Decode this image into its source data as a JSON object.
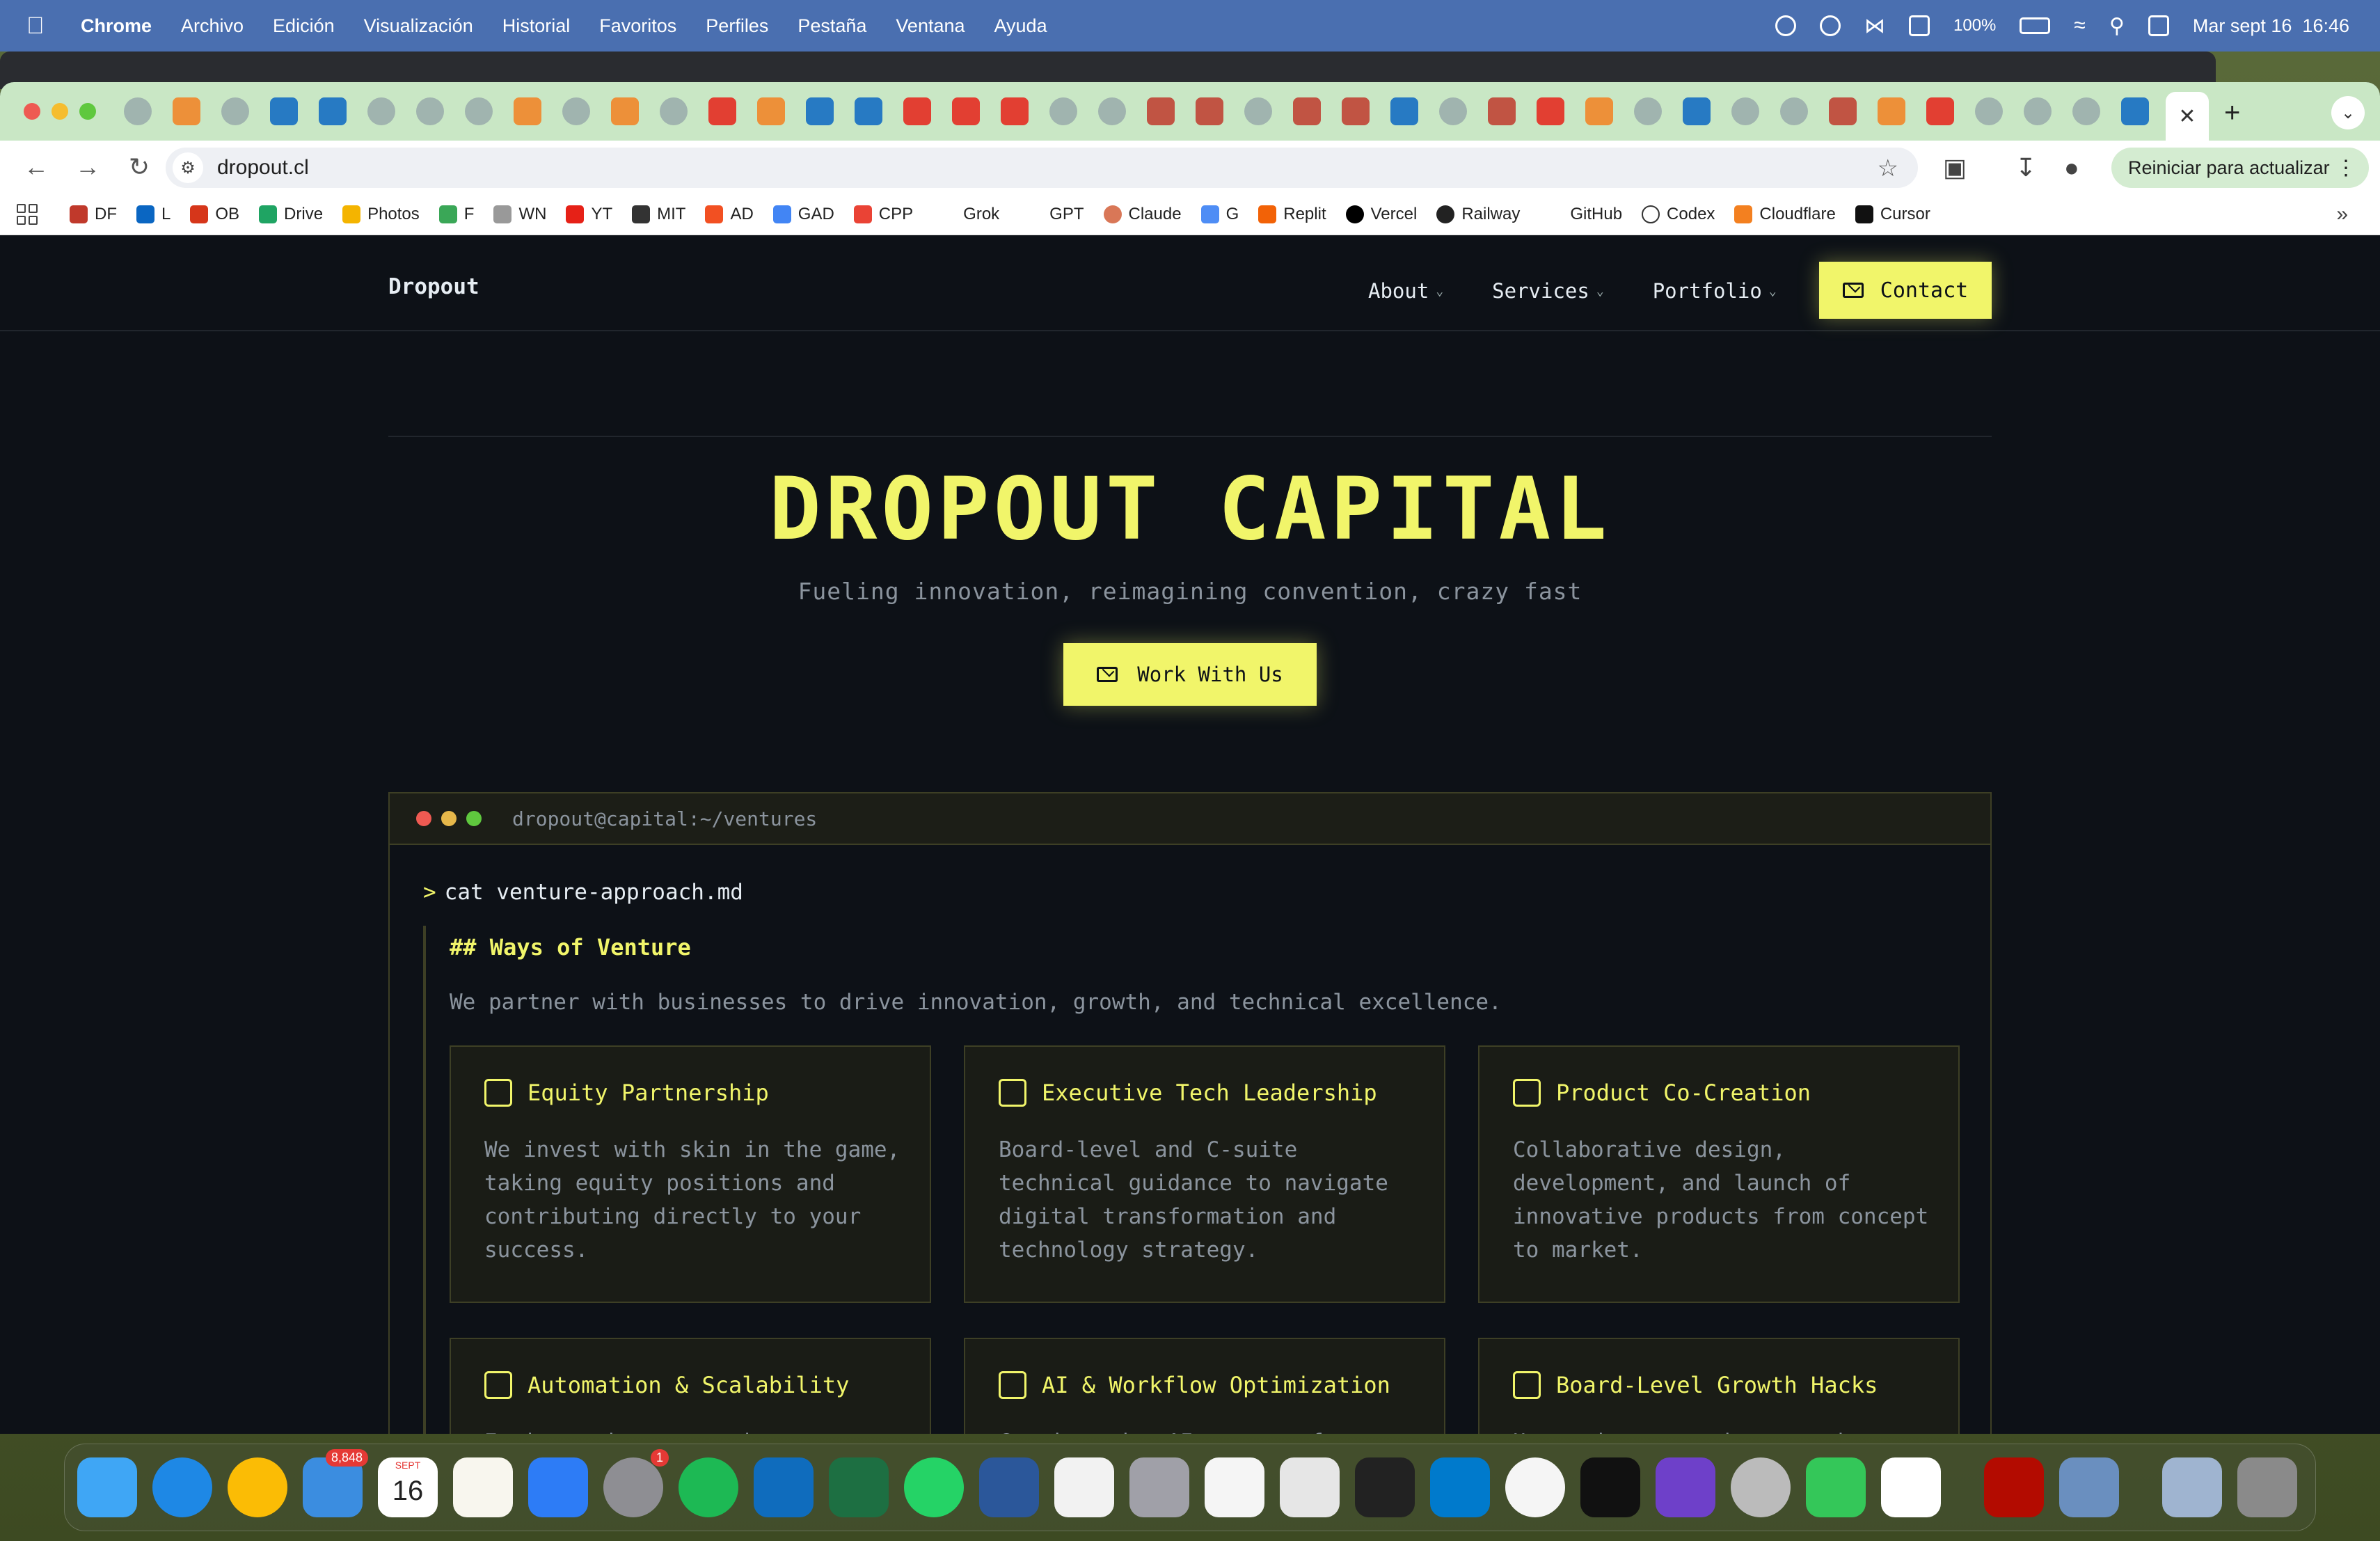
{
  "menubar": {
    "app": "Chrome",
    "items": [
      "Archivo",
      "Edición",
      "Visualización",
      "Historial",
      "Favoritos",
      "Perfiles",
      "Pestaña",
      "Ventana",
      "Ayuda"
    ],
    "battery": "100%",
    "datetime": "Mar sept 16  16:46"
  },
  "browser": {
    "url": "dropout.cl",
    "update_button": "Reiniciar para actualizar",
    "bookmarks": [
      "DF",
      "L",
      "OB",
      "Drive",
      "Photos",
      "F",
      "WN",
      "YT",
      "MIT",
      "AD",
      "GAD",
      "CPP",
      "Grok",
      "GPT",
      "Claude",
      "G",
      "Replit",
      "Vercel",
      "Railway",
      "GitHub",
      "Codex",
      "Cloudflare",
      "Cursor"
    ]
  },
  "site": {
    "brand": "Dropout",
    "nav": {
      "about": "About",
      "services": "Services",
      "portfolio": "Portfolio",
      "contact": "Contact"
    },
    "hero": {
      "title": "DROPOUT CAPITAL",
      "subtitle": "Fueling innovation, reimagining convention, crazy fast",
      "cta": "Work With Us"
    },
    "terminal": {
      "path": "dropout@capital:~/ventures",
      "command": "cat venture-approach.md",
      "heading": "## Ways of Venture",
      "intro": "We partner with businesses to drive innovation, growth, and technical excellence.",
      "cards": [
        {
          "title": "Equity Partnership",
          "body": "We invest with skin in the game, taking equity positions and contributing directly to your success.",
          "icon": "handshake-icon"
        },
        {
          "title": "Executive Tech Leadership",
          "body": "Board-level and C-suite technical guidance to navigate digital transformation and technology strategy.",
          "icon": "briefcase-icon"
        },
        {
          "title": "Product Co-Creation",
          "body": "Collaborative design, development, and launch of innovative products from concept to market.",
          "icon": "magic-wand-icon"
        },
        {
          "title": "Automation & Scalability",
          "body": "Engineered systems that automate processes and create",
          "icon": "workflow-icon"
        },
        {
          "title": "AI & Workflow Optimization",
          "body": "Cutting-edge AI to transform operations, optimize",
          "icon": "brain-icon"
        },
        {
          "title": "Board-Level Growth Hacks",
          "body": "Up-to-date creative growth solutions that unlock new",
          "icon": "chart-line-icon"
        }
      ]
    }
  },
  "dock": {
    "mail_badge": "8,848",
    "calendar_month": "SEPT",
    "calendar_day": "16",
    "settings_badge": "1"
  },
  "colors": {
    "accent": "#f1f56a",
    "page_bg": "#0d1117",
    "card_bg": "#1a1c16"
  }
}
